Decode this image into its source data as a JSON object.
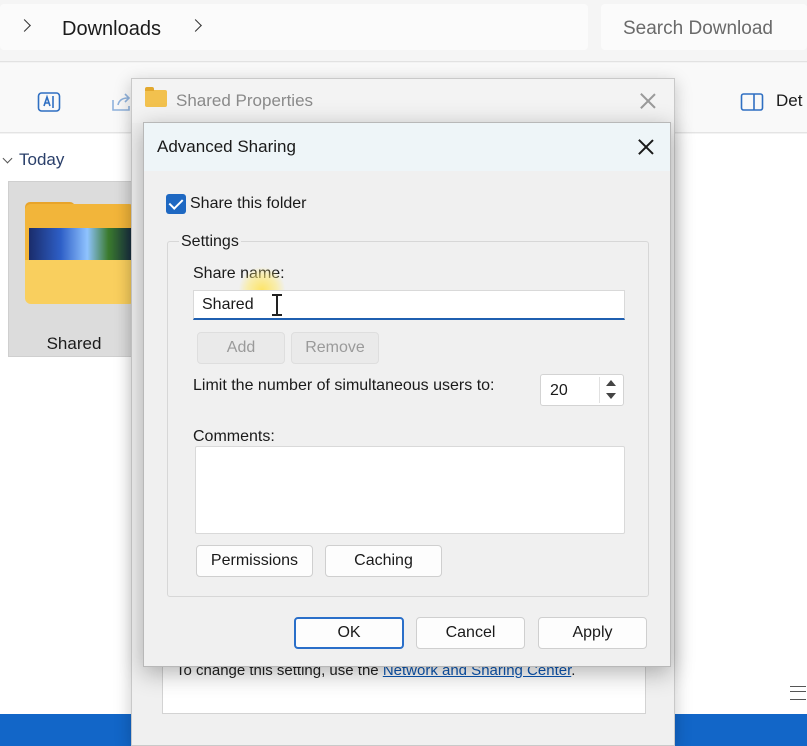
{
  "explorer": {
    "breadcrumb": "Downloads",
    "search_placeholder": "Search Download",
    "details_label": "Det",
    "group_label": "Today",
    "folder_name": "Shared"
  },
  "properties_dialog": {
    "title": "Shared Properties",
    "network_text": "To change this setting, use the ",
    "network_link": "Network and Sharing Center",
    "network_suffix": "."
  },
  "advanced_sharing": {
    "title": "Advanced Sharing",
    "share_checkbox_label": "Share this folder",
    "share_checked": true,
    "settings_legend": "Settings",
    "share_name_label": "Share name:",
    "share_name_value": "Shared",
    "add_label": "Add",
    "remove_label": "Remove",
    "limit_label": "Limit the number of simultaneous users to:",
    "limit_value": "20",
    "comments_label": "Comments:",
    "comments_value": "",
    "permissions_label": "Permissions",
    "caching_label": "Caching",
    "ok_label": "OK",
    "cancel_label": "Cancel",
    "apply_label": "Apply"
  },
  "icons": {
    "address_chevrons": "chevron-right-icon",
    "toolbar": [
      "rename-icon",
      "share-icon",
      "details-pane-icon"
    ],
    "titlebar_folder": "folder-icon",
    "close": "close-icon",
    "checkbox": "checkmark-icon",
    "cursor": "text-cursor-icon",
    "overflow": "hamburger-menu-icon"
  },
  "colors": {
    "accent": "#1e68c2",
    "taskbar": "#1266c8",
    "link": "#0b56b3",
    "folder": "#f2b53a"
  }
}
